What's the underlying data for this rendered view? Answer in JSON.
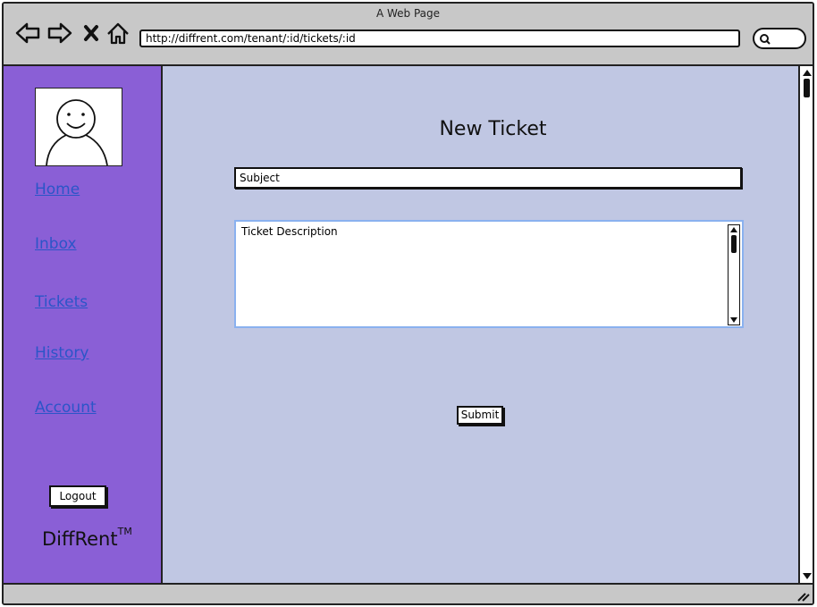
{
  "window": {
    "title": "A Web Page"
  },
  "browser": {
    "url": "http://diffrent.com/tenant/:id/tickets/:id",
    "icons": [
      "back-arrow-icon",
      "forward-arrow-icon",
      "close-icon",
      "home-icon",
      "search-icon"
    ]
  },
  "sidebar": {
    "avatar_icon": "user-avatar-icon",
    "items": [
      {
        "label": "Home"
      },
      {
        "label": "Inbox"
      },
      {
        "label": "Tickets"
      },
      {
        "label": "History"
      },
      {
        "label": "Account"
      }
    ],
    "logout_label": "Logout",
    "brand": "DiffRent",
    "trademark": "TM"
  },
  "main": {
    "title": "New Ticket",
    "subject_value": "Subject",
    "description_value": "Ticket Description",
    "submit_label": "Submit"
  },
  "colors": {
    "sidebar_bg": "#8a5fd6",
    "main_bg": "#c0c7e3",
    "link": "#2b55c8",
    "chrome": "#c8c8c8",
    "textarea_border": "#8ab1ef"
  }
}
